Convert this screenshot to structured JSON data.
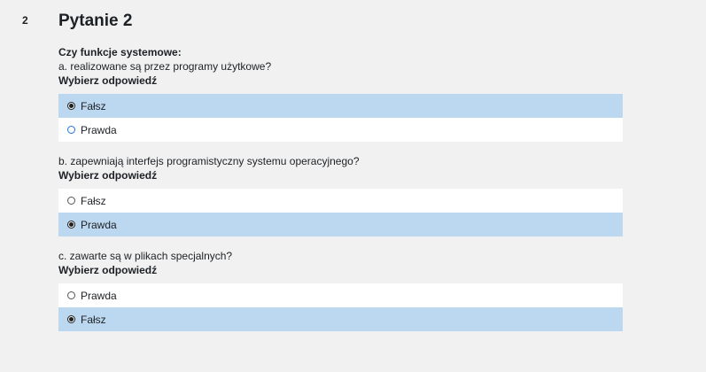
{
  "question": {
    "number": "2",
    "title": "Pytanie 2",
    "intro": "Czy funkcje systemowe:",
    "subquestions": [
      {
        "text": "a. realizowane są przez programy użytkowe?",
        "prompt": "Wybierz odpowiedź",
        "options": [
          {
            "label": "Fałsz",
            "selected": true
          },
          {
            "label": "Prawda",
            "selected": false
          }
        ]
      },
      {
        "text": "b. zapewniają interfejs programistyczny systemu operacyjnego?",
        "prompt": "Wybierz odpowiedź",
        "options": [
          {
            "label": "Fałsz",
            "selected": false
          },
          {
            "label": "Prawda",
            "selected": true
          }
        ]
      },
      {
        "text": "c. zawarte są w plikach specjalnych?",
        "prompt": "Wybierz odpowiedź",
        "options": [
          {
            "label": "Prawda",
            "selected": false
          },
          {
            "label": "Fałsz",
            "selected": true
          }
        ]
      }
    ]
  },
  "colors": {
    "selected_bg": "#bcd8f0",
    "option_bg": "#ffffff",
    "page_bg": "#f1f1f1",
    "focus_ring": "#1a73e8"
  }
}
